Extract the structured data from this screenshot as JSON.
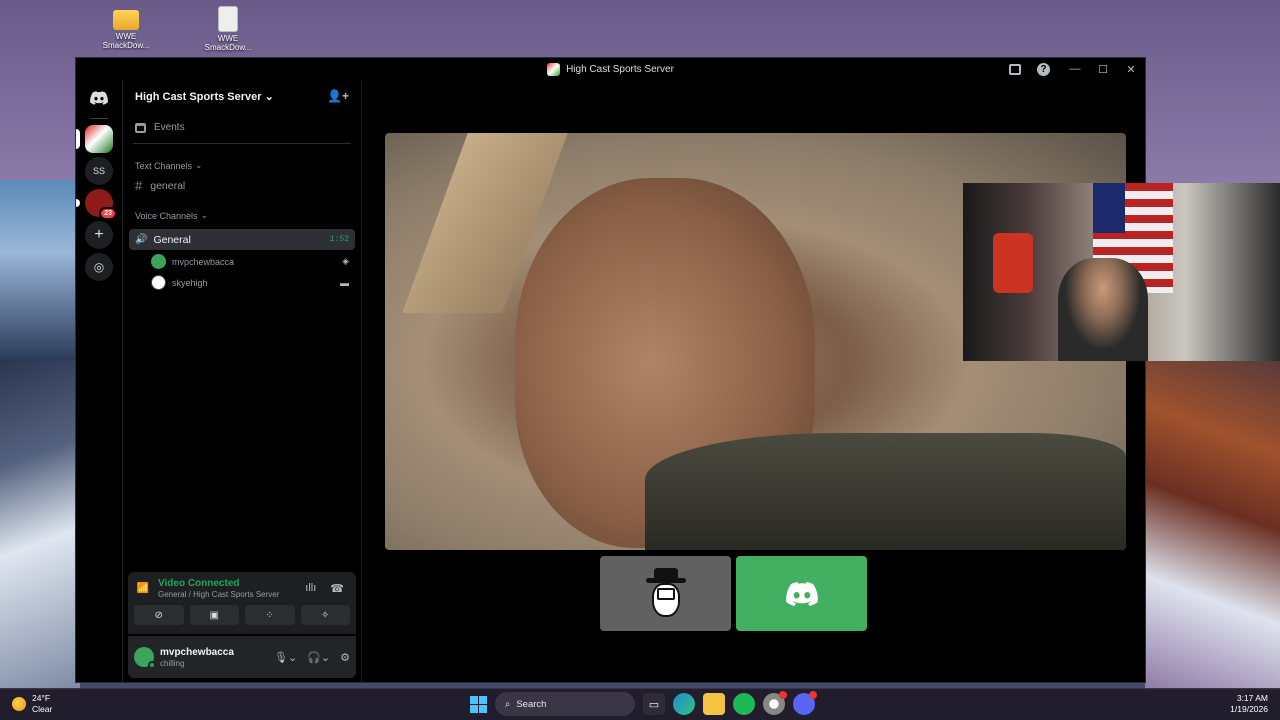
{
  "desktop": {
    "icons": [
      {
        "label": "WWE SmackDow..."
      },
      {
        "label": "WWE SmackDow..."
      }
    ]
  },
  "window": {
    "title": "High Cast Sports Server"
  },
  "rail": {
    "servers": [
      {
        "name": "High Cast Sports",
        "abbr": ""
      },
      {
        "name": "SS",
        "abbr": "SS"
      },
      {
        "name": "Red server",
        "badge": "23"
      }
    ]
  },
  "sidebar": {
    "server_name": "High Cast Sports Server",
    "events_label": "Events",
    "text_category": "Text Channels",
    "text_channels": [
      {
        "name": "general"
      }
    ],
    "voice_category": "Voice Channels",
    "voice_channel": {
      "name": "General",
      "timer": "1:52"
    },
    "voice_users": [
      {
        "name": "mvpchewbacca"
      },
      {
        "name": "skyehigh"
      }
    ]
  },
  "voice_panel": {
    "status": "Video Connected",
    "location": "General / High Cast Sports Server"
  },
  "user": {
    "name": "mvpchewbacca",
    "status": "chilling"
  },
  "taskbar": {
    "weather_temp": "24°F",
    "weather_cond": "Clear",
    "search_placeholder": "Search",
    "time": "3:17 AM",
    "date": "1/19/2026"
  },
  "colors": {
    "accent_green": "#23a55a",
    "discord_blurple": "#5865f2",
    "badge_red": "#f23f43"
  }
}
